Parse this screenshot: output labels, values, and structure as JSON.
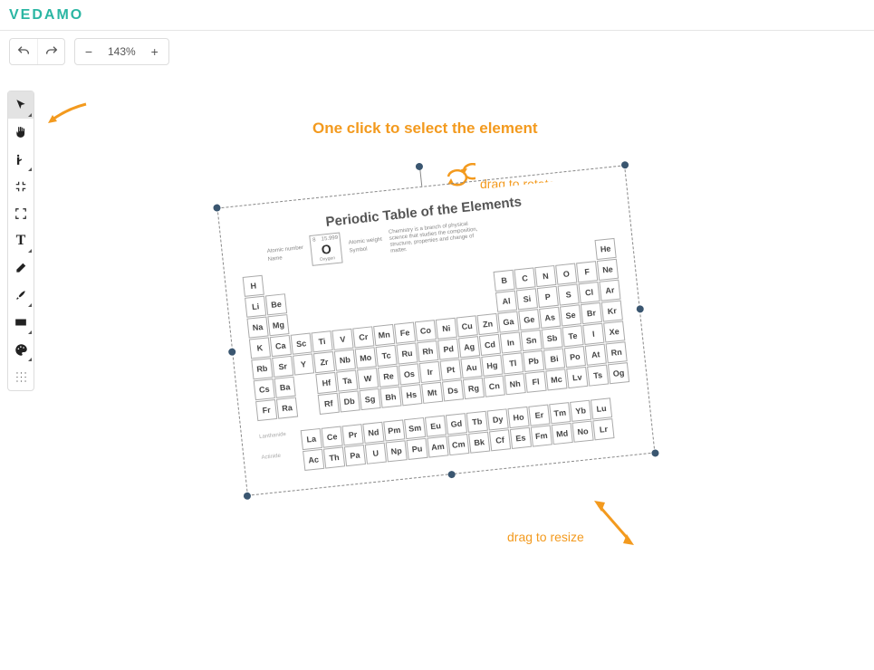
{
  "brand": "VEDAMO",
  "toolbar_top": {
    "zoom_value": "143%"
  },
  "annotations": {
    "title": "One click to select the element",
    "rotate": "drag to rotate",
    "resize": "drag to resize"
  },
  "content": {
    "title": "Periodic Table of the Elements",
    "legend": {
      "atomic_number_label": "Atomic number",
      "atomic_weight_label": "Atomic weight",
      "symbol_label": "Symbol",
      "name_label": "Name",
      "sample_number": "8",
      "sample_weight": "15.999",
      "sample_symbol": "O",
      "sample_name": "Oxygen"
    },
    "description": "Chemistry is a branch of physical science that studies the composition, structure, properties and change of matter.",
    "series": {
      "lanthanide": "Lanthanide",
      "actinide": "Actinide"
    },
    "grid": [
      {
        "r": 0,
        "c": 0,
        "s": "H"
      },
      {
        "r": 0,
        "c": 17,
        "s": "He"
      },
      {
        "r": 1,
        "c": 0,
        "s": "Li"
      },
      {
        "r": 1,
        "c": 1,
        "s": "Be"
      },
      {
        "r": 1,
        "c": 12,
        "s": "B"
      },
      {
        "r": 1,
        "c": 13,
        "s": "C"
      },
      {
        "r": 1,
        "c": 14,
        "s": "N"
      },
      {
        "r": 1,
        "c": 15,
        "s": "O"
      },
      {
        "r": 1,
        "c": 16,
        "s": "F"
      },
      {
        "r": 1,
        "c": 17,
        "s": "Ne"
      },
      {
        "r": 2,
        "c": 0,
        "s": "Na"
      },
      {
        "r": 2,
        "c": 1,
        "s": "Mg"
      },
      {
        "r": 2,
        "c": 12,
        "s": "Al"
      },
      {
        "r": 2,
        "c": 13,
        "s": "Si"
      },
      {
        "r": 2,
        "c": 14,
        "s": "P"
      },
      {
        "r": 2,
        "c": 15,
        "s": "S"
      },
      {
        "r": 2,
        "c": 16,
        "s": "Cl"
      },
      {
        "r": 2,
        "c": 17,
        "s": "Ar"
      },
      {
        "r": 3,
        "c": 0,
        "s": "K"
      },
      {
        "r": 3,
        "c": 1,
        "s": "Ca"
      },
      {
        "r": 3,
        "c": 2,
        "s": "Sc"
      },
      {
        "r": 3,
        "c": 3,
        "s": "Ti"
      },
      {
        "r": 3,
        "c": 4,
        "s": "V"
      },
      {
        "r": 3,
        "c": 5,
        "s": "Cr"
      },
      {
        "r": 3,
        "c": 6,
        "s": "Mn"
      },
      {
        "r": 3,
        "c": 7,
        "s": "Fe"
      },
      {
        "r": 3,
        "c": 8,
        "s": "Co"
      },
      {
        "r": 3,
        "c": 9,
        "s": "Ni"
      },
      {
        "r": 3,
        "c": 10,
        "s": "Cu"
      },
      {
        "r": 3,
        "c": 11,
        "s": "Zn"
      },
      {
        "r": 3,
        "c": 12,
        "s": "Ga"
      },
      {
        "r": 3,
        "c": 13,
        "s": "Ge"
      },
      {
        "r": 3,
        "c": 14,
        "s": "As"
      },
      {
        "r": 3,
        "c": 15,
        "s": "Se"
      },
      {
        "r": 3,
        "c": 16,
        "s": "Br"
      },
      {
        "r": 3,
        "c": 17,
        "s": "Kr"
      },
      {
        "r": 4,
        "c": 0,
        "s": "Rb"
      },
      {
        "r": 4,
        "c": 1,
        "s": "Sr"
      },
      {
        "r": 4,
        "c": 2,
        "s": "Y"
      },
      {
        "r": 4,
        "c": 3,
        "s": "Zr"
      },
      {
        "r": 4,
        "c": 4,
        "s": "Nb"
      },
      {
        "r": 4,
        "c": 5,
        "s": "Mo"
      },
      {
        "r": 4,
        "c": 6,
        "s": "Tc"
      },
      {
        "r": 4,
        "c": 7,
        "s": "Ru"
      },
      {
        "r": 4,
        "c": 8,
        "s": "Rh"
      },
      {
        "r": 4,
        "c": 9,
        "s": "Pd"
      },
      {
        "r": 4,
        "c": 10,
        "s": "Ag"
      },
      {
        "r": 4,
        "c": 11,
        "s": "Cd"
      },
      {
        "r": 4,
        "c": 12,
        "s": "In"
      },
      {
        "r": 4,
        "c": 13,
        "s": "Sn"
      },
      {
        "r": 4,
        "c": 14,
        "s": "Sb"
      },
      {
        "r": 4,
        "c": 15,
        "s": "Te"
      },
      {
        "r": 4,
        "c": 16,
        "s": "I"
      },
      {
        "r": 4,
        "c": 17,
        "s": "Xe"
      },
      {
        "r": 5,
        "c": 0,
        "s": "Cs"
      },
      {
        "r": 5,
        "c": 1,
        "s": "Ba"
      },
      {
        "r": 5,
        "c": 3,
        "s": "Hf"
      },
      {
        "r": 5,
        "c": 4,
        "s": "Ta"
      },
      {
        "r": 5,
        "c": 5,
        "s": "W"
      },
      {
        "r": 5,
        "c": 6,
        "s": "Re"
      },
      {
        "r": 5,
        "c": 7,
        "s": "Os"
      },
      {
        "r": 5,
        "c": 8,
        "s": "Ir"
      },
      {
        "r": 5,
        "c": 9,
        "s": "Pt"
      },
      {
        "r": 5,
        "c": 10,
        "s": "Au"
      },
      {
        "r": 5,
        "c": 11,
        "s": "Hg"
      },
      {
        "r": 5,
        "c": 12,
        "s": "Tl"
      },
      {
        "r": 5,
        "c": 13,
        "s": "Pb"
      },
      {
        "r": 5,
        "c": 14,
        "s": "Bi"
      },
      {
        "r": 5,
        "c": 15,
        "s": "Po"
      },
      {
        "r": 5,
        "c": 16,
        "s": "At"
      },
      {
        "r": 5,
        "c": 17,
        "s": "Rn"
      },
      {
        "r": 6,
        "c": 0,
        "s": "Fr"
      },
      {
        "r": 6,
        "c": 1,
        "s": "Ra"
      },
      {
        "r": 6,
        "c": 3,
        "s": "Rf"
      },
      {
        "r": 6,
        "c": 4,
        "s": "Db"
      },
      {
        "r": 6,
        "c": 5,
        "s": "Sg"
      },
      {
        "r": 6,
        "c": 6,
        "s": "Bh"
      },
      {
        "r": 6,
        "c": 7,
        "s": "Hs"
      },
      {
        "r": 6,
        "c": 8,
        "s": "Mt"
      },
      {
        "r": 6,
        "c": 9,
        "s": "Ds"
      },
      {
        "r": 6,
        "c": 10,
        "s": "Rg"
      },
      {
        "r": 6,
        "c": 11,
        "s": "Cn"
      },
      {
        "r": 6,
        "c": 12,
        "s": "Nh"
      },
      {
        "r": 6,
        "c": 13,
        "s": "Fl"
      },
      {
        "r": 6,
        "c": 14,
        "s": "Mc"
      },
      {
        "r": 6,
        "c": 15,
        "s": "Lv"
      },
      {
        "r": 6,
        "c": 16,
        "s": "Ts"
      },
      {
        "r": 6,
        "c": 17,
        "s": "Og"
      },
      {
        "r": 7.6,
        "c": 2,
        "s": "La"
      },
      {
        "r": 7.6,
        "c": 3,
        "s": "Ce"
      },
      {
        "r": 7.6,
        "c": 4,
        "s": "Pr"
      },
      {
        "r": 7.6,
        "c": 5,
        "s": "Nd"
      },
      {
        "r": 7.6,
        "c": 6,
        "s": "Pm"
      },
      {
        "r": 7.6,
        "c": 7,
        "s": "Sm"
      },
      {
        "r": 7.6,
        "c": 8,
        "s": "Eu"
      },
      {
        "r": 7.6,
        "c": 9,
        "s": "Gd"
      },
      {
        "r": 7.6,
        "c": 10,
        "s": "Tb"
      },
      {
        "r": 7.6,
        "c": 11,
        "s": "Dy"
      },
      {
        "r": 7.6,
        "c": 12,
        "s": "Ho"
      },
      {
        "r": 7.6,
        "c": 13,
        "s": "Er"
      },
      {
        "r": 7.6,
        "c": 14,
        "s": "Tm"
      },
      {
        "r": 7.6,
        "c": 15,
        "s": "Yb"
      },
      {
        "r": 7.6,
        "c": 16,
        "s": "Lu"
      },
      {
        "r": 8.6,
        "c": 2,
        "s": "Ac"
      },
      {
        "r": 8.6,
        "c": 3,
        "s": "Th"
      },
      {
        "r": 8.6,
        "c": 4,
        "s": "Pa"
      },
      {
        "r": 8.6,
        "c": 5,
        "s": "U"
      },
      {
        "r": 8.6,
        "c": 6,
        "s": "Np"
      },
      {
        "r": 8.6,
        "c": 7,
        "s": "Pu"
      },
      {
        "r": 8.6,
        "c": 8,
        "s": "Am"
      },
      {
        "r": 8.6,
        "c": 9,
        "s": "Cm"
      },
      {
        "r": 8.6,
        "c": 10,
        "s": "Bk"
      },
      {
        "r": 8.6,
        "c": 11,
        "s": "Cf"
      },
      {
        "r": 8.6,
        "c": 12,
        "s": "Es"
      },
      {
        "r": 8.6,
        "c": 13,
        "s": "Fm"
      },
      {
        "r": 8.6,
        "c": 14,
        "s": "Md"
      },
      {
        "r": 8.6,
        "c": 15,
        "s": "No"
      },
      {
        "r": 8.6,
        "c": 16,
        "s": "Lr"
      }
    ]
  }
}
